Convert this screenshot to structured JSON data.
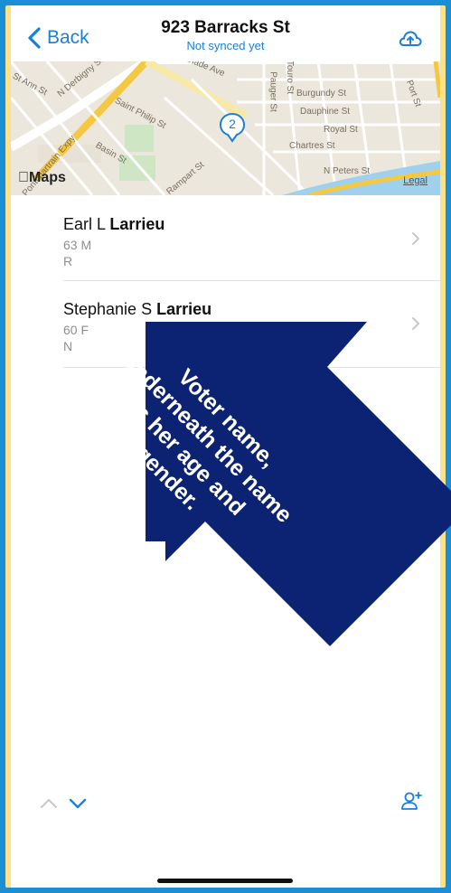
{
  "header": {
    "back_label": "Back",
    "title": "923 Barracks St",
    "subtitle": "Not synced yet"
  },
  "map": {
    "streets": [
      "Esplanade Ave",
      "Touro St",
      "Burgundy St",
      "Dauphine St",
      "Royal St",
      "Chartres St",
      "N Peters St",
      "Saint Philip St",
      "Basin St",
      "Rampart St",
      "Pauger St",
      "Port St",
      "St Ann St",
      "N Derbigny St",
      "Pontchartrain Expy"
    ],
    "cluster_count": "2",
    "provider": "Maps",
    "legal_label": "Legal"
  },
  "voters": [
    {
      "first": "Earl L",
      "last": "Larrieu",
      "age_gender": "63 M",
      "party": "R"
    },
    {
      "first": "Stephanie S",
      "last": "Larrieu",
      "age_gender": "60 F",
      "party": "N"
    }
  ],
  "annotation": {
    "text": "Voter name, underneath the name is her age and gender.",
    "color": "#0c2272"
  },
  "colors": {
    "accent": "#1a7fd8",
    "frame_outer": "#1a8fd6",
    "frame_inner": "#fbe28a"
  }
}
